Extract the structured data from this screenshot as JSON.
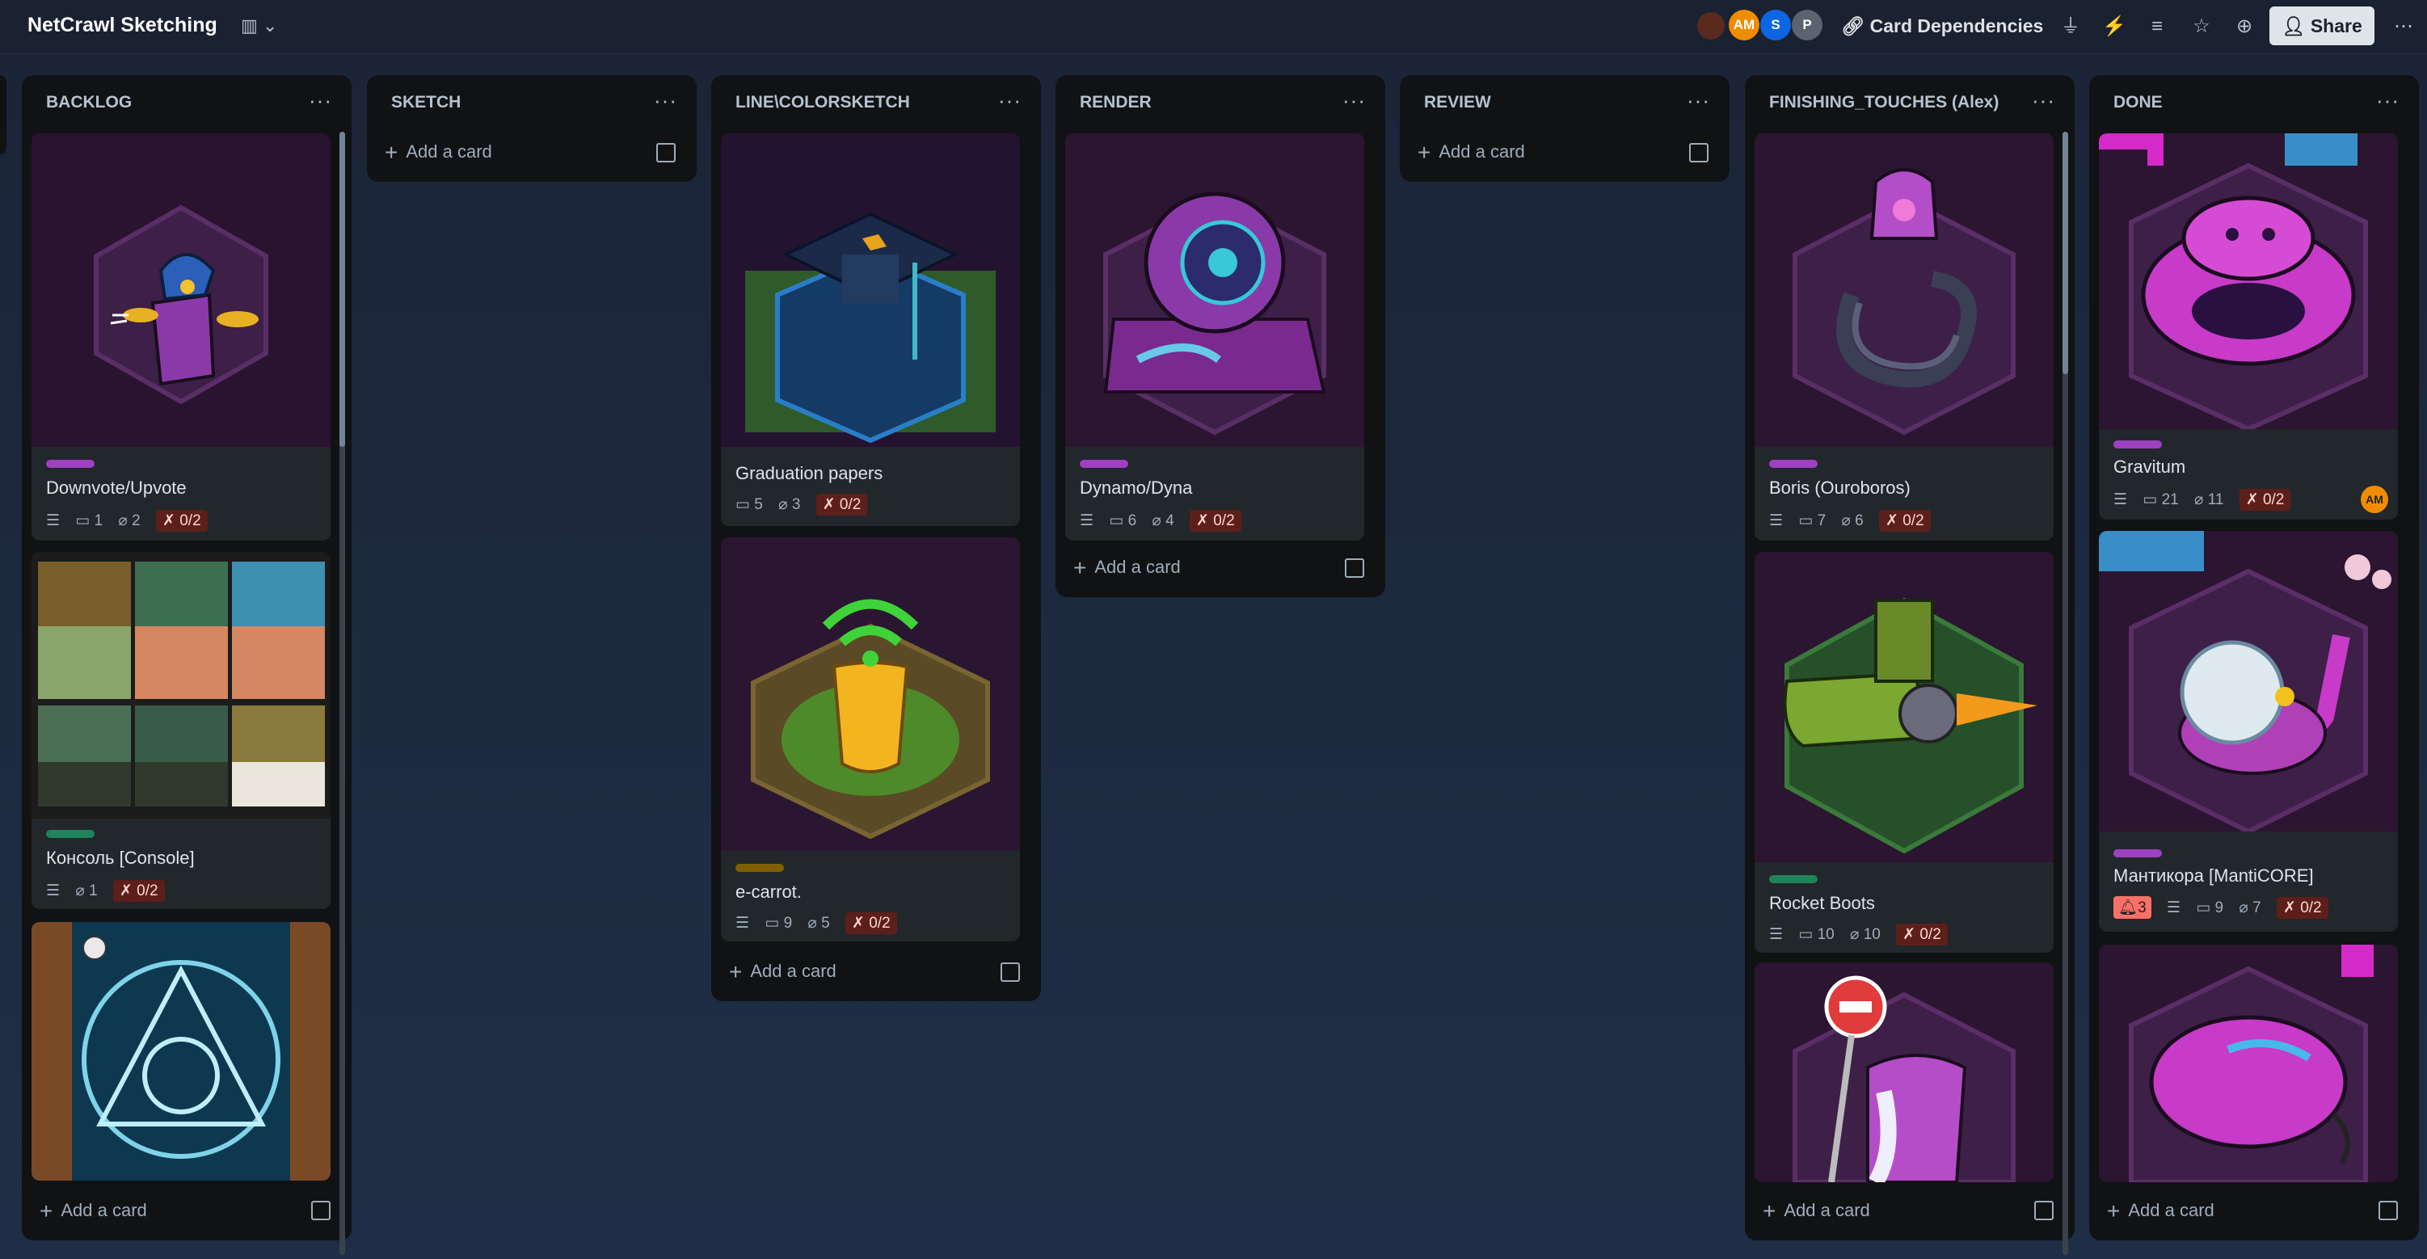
{
  "board": {
    "title": "NetCrawl Sketching",
    "view_switch": "▥ ⌄",
    "avatars": [
      "AM",
      "S",
      "P"
    ],
    "powerup": "Card Dependencies",
    "share": "Share"
  },
  "colors": {
    "purple_label": "#9f3fc2",
    "green_label": "#1f845a",
    "yellow_label": "#7f5f01",
    "red_badge": "#5d1f1a"
  },
  "lists": [
    {
      "name": "BACKLOG",
      "cards": [
        {
          "title": "Downvote/Upvote",
          "comments": "1",
          "attachments": "2",
          "checklist": "0/2"
        },
        {
          "title": "Консоль [Console]",
          "attachments": "1",
          "checklist": "0/2"
        },
        {
          "title": ""
        }
      ],
      "add": "Add a card"
    },
    {
      "name": "SKETCH",
      "add": "Add a card"
    },
    {
      "name": "LINE\\COLORSKETCH",
      "cards": [
        {
          "title": "Graduation papers",
          "comments": "5",
          "attachments": "3",
          "checklist": "0/2"
        },
        {
          "title": "e-carrot.",
          "comments": "9",
          "attachments": "5",
          "checklist": "0/2"
        }
      ],
      "add": "Add a card"
    },
    {
      "name": "RENDER",
      "cards": [
        {
          "title": "Dynamo/Dyna",
          "comments": "6",
          "attachments": "4",
          "checklist": "0/2"
        }
      ],
      "add": "Add a card"
    },
    {
      "name": "REVIEW",
      "add": "Add a card"
    },
    {
      "name": "FINISHING_TOUCHES (Alex)",
      "cards": [
        {
          "title": "Boris (Ouroboros)",
          "comments": "7",
          "attachments": "6",
          "checklist": "0/2"
        },
        {
          "title": "Rocket Boots",
          "comments": "10",
          "attachments": "10",
          "checklist": "0/2"
        },
        {
          "title": ""
        }
      ],
      "add": "Add a card"
    },
    {
      "name": "DONE",
      "cards": [
        {
          "title": "Gravitum",
          "comments": "21",
          "attachments": "11",
          "checklist": "0/2",
          "member": "AM"
        },
        {
          "title": "Мантикора [MantiCORE]",
          "notifications": "3",
          "comments": "9",
          "attachments": "7",
          "checklist": "0/2"
        },
        {
          "title": ""
        }
      ],
      "add": "Add a card"
    }
  ]
}
